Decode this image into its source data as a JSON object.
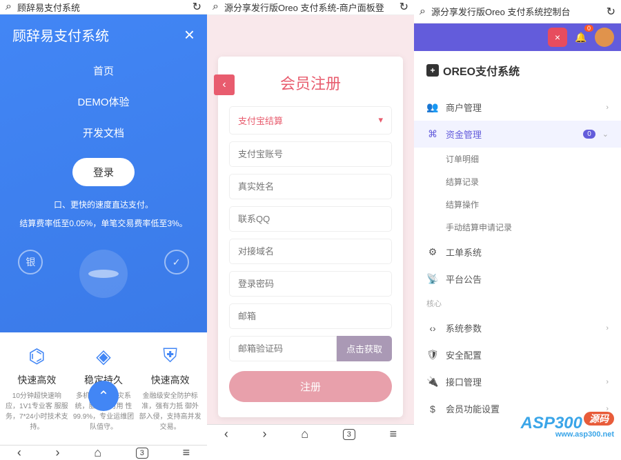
{
  "screen1": {
    "addr_title": "顾辞易支付系统",
    "header_title": "顾辞易支付系统",
    "nav": [
      "首页",
      "DEMO体验",
      "开发文档"
    ],
    "login": "登录",
    "tagline1": "口、更快的速度直达支付。",
    "tagline2": "结算费率低至0.05%，单笔交易费率低至3%。",
    "features": [
      {
        "title": "快速高效",
        "desc": "10分钟超快速响应，1V1专业客 服服务，7*24小时技术支持。"
      },
      {
        "title": "稳定持久",
        "desc": "多机房异地容灾系统，服务器可用 性99.9%，专业运维团队值守。"
      },
      {
        "title": "快速高效",
        "desc": "金融级安全防护标准，强有力抵 御外部入侵，支持高并发交易。"
      }
    ],
    "tab_count": "3"
  },
  "screen2": {
    "addr_title": "源分享发行版Oreo 支付系统-商户面板登",
    "title": "会员注册",
    "select_value": "支付宝结算",
    "inputs": [
      "支付宝账号",
      "真实姓名",
      "联系QQ",
      "对接域名",
      "登录密码",
      "邮箱"
    ],
    "verify_placeholder": "邮箱验证码",
    "verify_btn": "点击获取",
    "submit": "注册",
    "tab_count": "3"
  },
  "screen3": {
    "addr_title": "源分享发行版Oreo 支付系统控制台",
    "badge_count": "0",
    "brand": "OREO支付系统",
    "menu": [
      {
        "icon": "👥",
        "label": "商户管理",
        "chevron": true
      },
      {
        "icon": "⌘",
        "label": "资金管理",
        "active": true,
        "badge": "0",
        "chevron_down": true
      }
    ],
    "submenu": [
      "订单明细",
      "结算记录",
      "结算操作",
      "手动结算申请记录"
    ],
    "menu2": [
      {
        "icon": "⚙",
        "label": "工单系统"
      },
      {
        "icon": "📡",
        "label": "平台公告"
      }
    ],
    "section": "核心",
    "menu3": [
      {
        "icon": "‹›",
        "label": "系统参数",
        "chevron": true
      },
      {
        "icon": "🛡",
        "label": "安全配置"
      },
      {
        "icon": "🔌",
        "label": "接口管理",
        "chevron": true
      },
      {
        "icon": "$",
        "label": "会员功能设置",
        "chevron": true
      }
    ]
  },
  "watermark": {
    "big": "ASP300",
    "pill": "源码",
    "url": "www.asp300.net"
  }
}
